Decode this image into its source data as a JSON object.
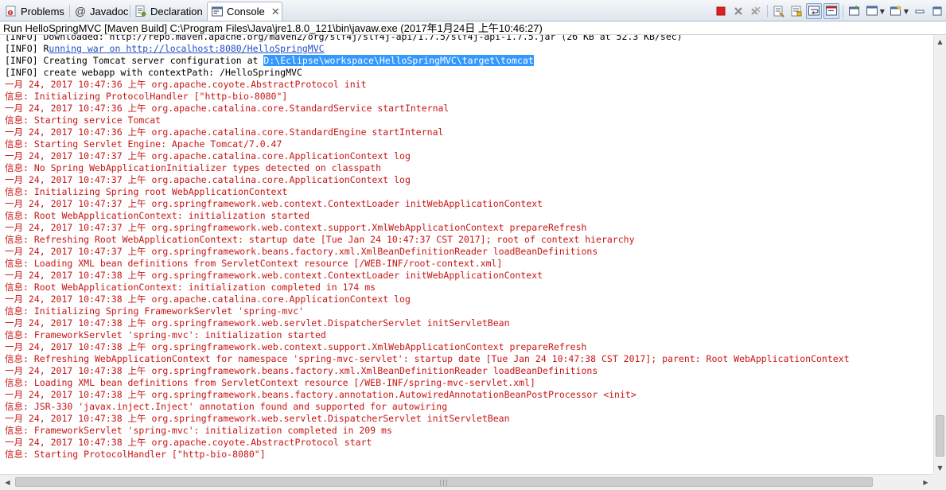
{
  "tabs": [
    {
      "label": "Problems",
      "icon": "problems-icon"
    },
    {
      "label": "Javadoc",
      "icon": "at-icon",
      "glyph": "@"
    },
    {
      "label": "Declaration",
      "icon": "declaration-icon"
    },
    {
      "label": "Console",
      "icon": "console-icon",
      "active": true,
      "close": "✕"
    }
  ],
  "toolbar": {
    "icons": [
      "terminate-icon",
      "remove-launch-icon",
      "remove-all-terminated-icon",
      "clear-console-icon",
      "scroll-lock-icon",
      "word-wrap-icon",
      "show-on-output-icon",
      "pin-console-icon",
      "display-console-icon",
      "new-console-icon",
      "minimize-icon",
      "maximize-icon"
    ]
  },
  "run_description": "Run HelloSpringMVC [Maven Build] C:\\Program Files\\Java\\jre1.8.0_121\\bin\\javaw.exe (2017年1月24日 上午10:46:27)",
  "colors": {
    "stderr": "#c81414",
    "stdout": "#000000",
    "link": "#1f4ec8",
    "selection": "#3399ff"
  },
  "console": {
    "line_downloaded": "[INFO] Downloaded: http://repo.maven.apache.org/maven2/org/slf4j/slf4j-api/1.7.5/slf4j-api-1.7.5.jar (26 KB at 52.3 KB/sec)",
    "line_running_prefix": "[INFO] R",
    "line_running_link": "unning war on http://localhost:8080/HelloSpringMVC",
    "line_creating_prefix": "[INFO] Creating Tomcat server configuration at ",
    "line_creating_selected": "D:\\Eclipse\\workspace\\HelloSpringMVC\\target\\tomcat",
    "line_create_webapp": "[INFO] create webapp with contextPath: /HelloSpringMVC",
    "stderr_lines": [
      "一月 24, 2017 10:47:36 上午 org.apache.coyote.AbstractProtocol init",
      "信息: Initializing ProtocolHandler [\"http-bio-8080\"]",
      "一月 24, 2017 10:47:36 上午 org.apache.catalina.core.StandardService startInternal",
      "信息: Starting service Tomcat",
      "一月 24, 2017 10:47:36 上午 org.apache.catalina.core.StandardEngine startInternal",
      "信息: Starting Servlet Engine: Apache Tomcat/7.0.47",
      "一月 24, 2017 10:47:37 上午 org.apache.catalina.core.ApplicationContext log",
      "信息: No Spring WebApplicationInitializer types detected on classpath",
      "一月 24, 2017 10:47:37 上午 org.apache.catalina.core.ApplicationContext log",
      "信息: Initializing Spring root WebApplicationContext",
      "一月 24, 2017 10:47:37 上午 org.springframework.web.context.ContextLoader initWebApplicationContext",
      "信息: Root WebApplicationContext: initialization started",
      "一月 24, 2017 10:47:37 上午 org.springframework.web.context.support.XmlWebApplicationContext prepareRefresh",
      "信息: Refreshing Root WebApplicationContext: startup date [Tue Jan 24 10:47:37 CST 2017]; root of context hierarchy",
      "一月 24, 2017 10:47:37 上午 org.springframework.beans.factory.xml.XmlBeanDefinitionReader loadBeanDefinitions",
      "信息: Loading XML bean definitions from ServletContext resource [/WEB-INF/root-context.xml]",
      "一月 24, 2017 10:47:38 上午 org.springframework.web.context.ContextLoader initWebApplicationContext",
      "信息: Root WebApplicationContext: initialization completed in 174 ms",
      "一月 24, 2017 10:47:38 上午 org.apache.catalina.core.ApplicationContext log",
      "信息: Initializing Spring FrameworkServlet 'spring-mvc'",
      "一月 24, 2017 10:47:38 上午 org.springframework.web.servlet.DispatcherServlet initServletBean",
      "信息: FrameworkServlet 'spring-mvc': initialization started",
      "一月 24, 2017 10:47:38 上午 org.springframework.web.context.support.XmlWebApplicationContext prepareRefresh",
      "信息: Refreshing WebApplicationContext for namespace 'spring-mvc-servlet': startup date [Tue Jan 24 10:47:38 CST 2017]; parent: Root WebApplicationContext",
      "一月 24, 2017 10:47:38 上午 org.springframework.beans.factory.xml.XmlBeanDefinitionReader loadBeanDefinitions",
      "信息: Loading XML bean definitions from ServletContext resource [/WEB-INF/spring-mvc-servlet.xml]",
      "一月 24, 2017 10:47:38 上午 org.springframework.beans.factory.annotation.AutowiredAnnotationBeanPostProcessor <init>",
      "信息: JSR-330 'javax.inject.Inject' annotation found and supported for autowiring",
      "一月 24, 2017 10:47:38 上午 org.springframework.web.servlet.DispatcherServlet initServletBean",
      "信息: FrameworkServlet 'spring-mvc': initialization completed in 209 ms",
      "一月 24, 2017 10:47:38 上午 org.apache.coyote.AbstractProtocol start",
      "信息: Starting ProtocolHandler [\"http-bio-8080\"]"
    ]
  },
  "scrollbars": {
    "vertical_up": "▲",
    "vertical_down": "▼",
    "horizontal_left": "◀",
    "horizontal_right": "▶",
    "grip": "|||"
  }
}
